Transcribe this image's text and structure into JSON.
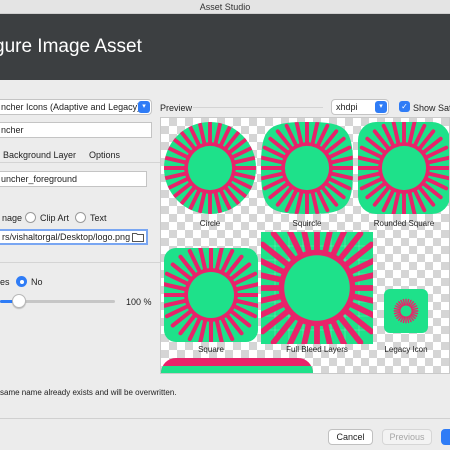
{
  "window": {
    "title": "Asset Studio"
  },
  "header": {
    "title": "gure Image Asset"
  },
  "form": {
    "icon_type": "ncher Icons (Adaptive and Legacy)",
    "name": "ncher",
    "tabs": [
      "Background Layer",
      "Options"
    ],
    "layer_name": "uncher_foreground",
    "asset_type_label": "nage",
    "asset_types": [
      "Clip Art",
      "Text"
    ],
    "path": "rs/vishaltorgal/Desktop/logo.png",
    "trim_label": "es",
    "trim_value": "No",
    "resize_value": "100 %",
    "resize_level": 0.1
  },
  "preview": {
    "label": "Preview",
    "density": "xhdpi",
    "show_safe_zone": "Show Saf",
    "show_safe_zone_checked": true,
    "icons": [
      {
        "caption": "Circle",
        "shape": "circle"
      },
      {
        "caption": "Squircle",
        "shape": "squircle"
      },
      {
        "caption": "Rounded Square",
        "shape": "rounded-square"
      },
      {
        "caption": "Square",
        "shape": "square"
      },
      {
        "caption": "Full Bleed Layers",
        "shape": "full-bleed"
      },
      {
        "caption": "Legacy Icon",
        "shape": "legacy"
      }
    ]
  },
  "warning": "same name already exists and will be overwritten.",
  "buttons": {
    "cancel": "Cancel",
    "previous": "Previous"
  },
  "colors": {
    "header": "#3c3f41",
    "accent": "#2f7cf6",
    "icon_green": "#1ee18a",
    "icon_pink": "#e8236a"
  }
}
